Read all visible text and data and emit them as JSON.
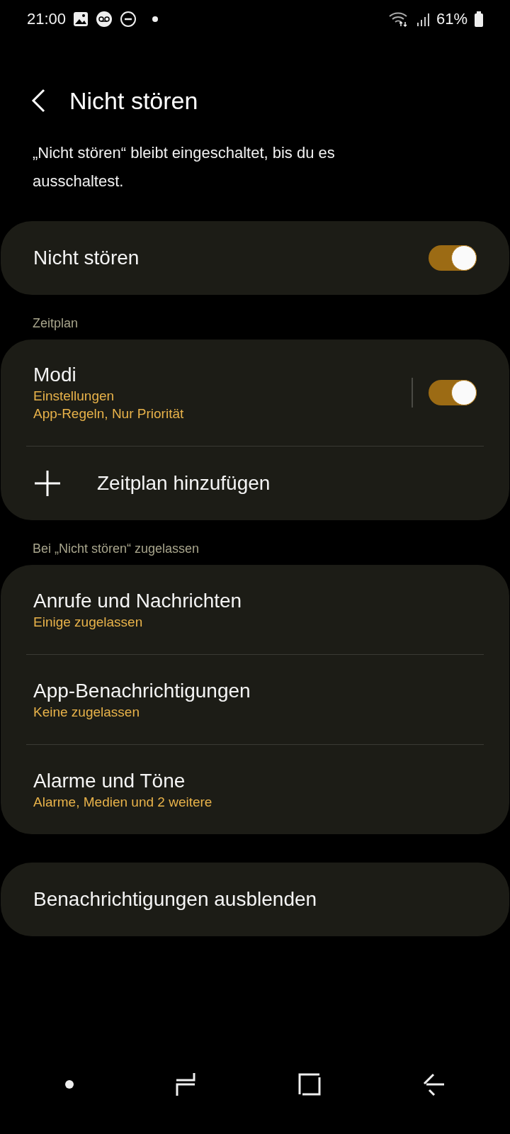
{
  "status_bar": {
    "time": "21:00",
    "battery": "61%"
  },
  "header": {
    "title": "Nicht stören"
  },
  "description": "„Nicht stören“ bleibt eingeschaltet, bis du es ausschaltest.",
  "cards": [
    {
      "items": [
        {
          "kind": "toggle",
          "title": "Nicht stören",
          "on": true
        }
      ]
    },
    {
      "section": "Zeitplan",
      "items": [
        {
          "kind": "split-toggle",
          "title": "Modi",
          "subtitles": [
            "Einstellungen",
            "App-Regeln, Nur Priorität"
          ],
          "on": true
        },
        {
          "kind": "add",
          "title": "Zeitplan hinzufügen"
        }
      ]
    },
    {
      "section": "Bei „Nicht stören“ zugelassen",
      "items": [
        {
          "kind": "nav",
          "title": "Anrufe und Nachrichten",
          "subtitles": [
            "Einige zugelassen"
          ]
        },
        {
          "kind": "nav",
          "title": "App-Benachrichtigungen",
          "subtitles": [
            "Keine zugelassen"
          ]
        },
        {
          "kind": "nav",
          "title": "Alarme und Töne",
          "subtitles": [
            "Alarme, Medien und 2 weitere"
          ]
        }
      ]
    },
    {
      "items": [
        {
          "kind": "nav",
          "title": "Benachrichtigungen ausblenden"
        }
      ]
    }
  ]
}
